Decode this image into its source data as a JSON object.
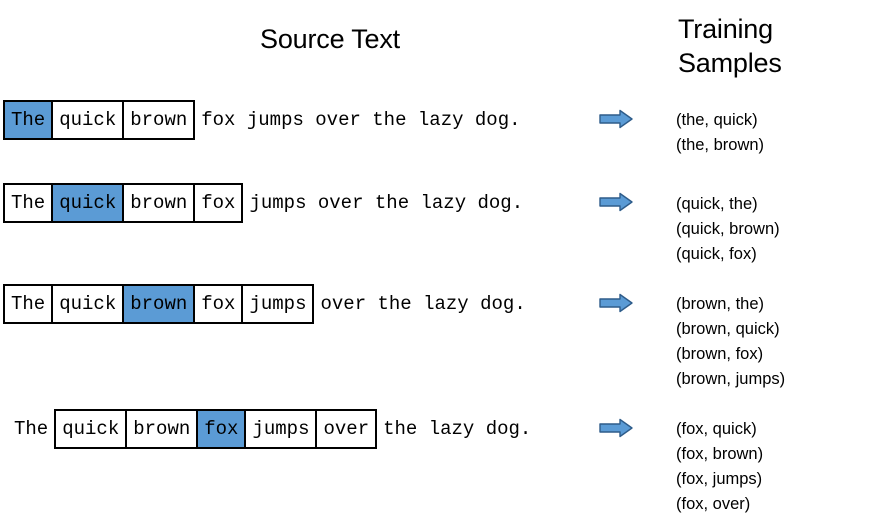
{
  "headings": {
    "source_text": "Source Text",
    "training_samples": "Training\nSamples"
  },
  "accent_color": "#5B9BD5",
  "arrow_fill": "#5B9BD5",
  "arrow_stroke": "#2E5C8A",
  "sentence_words": [
    "The",
    "quick",
    "brown",
    "fox",
    "jumps",
    "over",
    "the",
    "lazy",
    "dog."
  ],
  "rows": [
    {
      "id": "row-the",
      "lead": "",
      "window": [
        {
          "text": "The",
          "highlight": true
        },
        {
          "text": "quick",
          "highlight": false
        },
        {
          "text": "brown",
          "highlight": false
        }
      ],
      "tail": "fox jumps over the lazy dog.",
      "arrow": "right-arrow-icon",
      "samples": [
        "(the, quick)",
        "(the, brown)"
      ]
    },
    {
      "id": "row-quick",
      "lead": "",
      "window": [
        {
          "text": "The",
          "highlight": false
        },
        {
          "text": "quick",
          "highlight": true
        },
        {
          "text": "brown",
          "highlight": false
        },
        {
          "text": "fox",
          "highlight": false
        }
      ],
      "tail": "jumps over the lazy dog.",
      "arrow": "right-arrow-icon",
      "samples": [
        "(quick, the)",
        "(quick, brown)",
        "(quick, fox)"
      ]
    },
    {
      "id": "row-brown",
      "lead": "",
      "window": [
        {
          "text": "The",
          "highlight": false
        },
        {
          "text": "quick",
          "highlight": false
        },
        {
          "text": "brown",
          "highlight": true
        },
        {
          "text": "fox",
          "highlight": false
        },
        {
          "text": "jumps",
          "highlight": false
        }
      ],
      "tail": "over the lazy dog.",
      "arrow": "right-arrow-icon",
      "samples": [
        "(brown, the)",
        "(brown, quick)",
        "(brown, fox)",
        "(brown, jumps)"
      ]
    },
    {
      "id": "row-fox",
      "lead": "The",
      "window": [
        {
          "text": "quick",
          "highlight": false
        },
        {
          "text": "brown",
          "highlight": false
        },
        {
          "text": "fox",
          "highlight": true
        },
        {
          "text": "jumps",
          "highlight": false
        },
        {
          "text": "over",
          "highlight": false
        }
      ],
      "tail": "the lazy dog.",
      "arrow": "right-arrow-icon",
      "samples": [
        "(fox, quick)",
        "(fox, brown)",
        "(fox, jumps)",
        "(fox, over)"
      ]
    }
  ]
}
